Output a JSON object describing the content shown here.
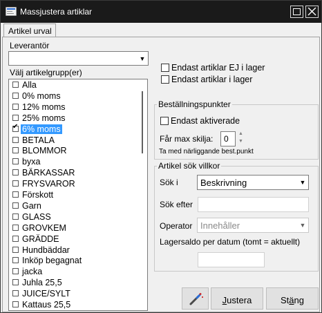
{
  "window": {
    "title": "Massjustera artiklar"
  },
  "tabs": [
    {
      "label": "Artikel urval"
    }
  ],
  "leverantor": {
    "label": "Leverantör",
    "value": ""
  },
  "artikelgrupp": {
    "label": "Välj artikelgrupp(er)",
    "items": [
      {
        "label": "Alla",
        "checked": false
      },
      {
        "label": "0% moms",
        "checked": false
      },
      {
        "label": "12% moms",
        "checked": false
      },
      {
        "label": "25% moms",
        "checked": false
      },
      {
        "label": "6% moms",
        "checked": true
      },
      {
        "label": "BETALA",
        "checked": false
      },
      {
        "label": "BLOMMOR",
        "checked": false
      },
      {
        "label": "byxa",
        "checked": false
      },
      {
        "label": "BÄRKASSAR",
        "checked": false
      },
      {
        "label": "FRYSVAROR",
        "checked": false
      },
      {
        "label": "Förskott",
        "checked": false
      },
      {
        "label": "Garn",
        "checked": false
      },
      {
        "label": "GLASS",
        "checked": false
      },
      {
        "label": "GROVKEM",
        "checked": false
      },
      {
        "label": "GRÄDDE",
        "checked": false
      },
      {
        "label": "Hundbäddar",
        "checked": false
      },
      {
        "label": "Inköp begagnat",
        "checked": false
      },
      {
        "label": "jacka",
        "checked": false
      },
      {
        "label": "Juhla 25,5",
        "checked": false
      },
      {
        "label": "JUICE/SYLT",
        "checked": false
      },
      {
        "label": "Kattaus 25,5",
        "checked": false
      }
    ]
  },
  "options": {
    "ej_i_lager": "Endast artiklar EJ i lager",
    "i_lager": "Endast artiklar i lager"
  },
  "bestallningspunkter": {
    "title": "Beställningspunkter",
    "endast_aktiverade": "Endast aktiverade",
    "max_skilja_label": "Får max skilja:",
    "max_skilja_value": "0",
    "narliggande": "Ta med närliggande best.punkt"
  },
  "sok": {
    "title": "Artikel sök villkor",
    "sok_i_label": "Sök i",
    "sok_i_value": "Beskrivning",
    "sok_efter_label": "Sök efter",
    "sok_efter_value": "",
    "operator_label": "Operator",
    "operator_value": "Innehåller",
    "lagersaldo_label": "Lagersaldo per datum (tomt = aktuellt)",
    "lagersaldo_value": ""
  },
  "buttons": {
    "justera_mnemonic": "J",
    "justera_rest": "ustera",
    "stang_pre": "St",
    "stang_mnemonic": "ä",
    "stang_post": "ng"
  }
}
